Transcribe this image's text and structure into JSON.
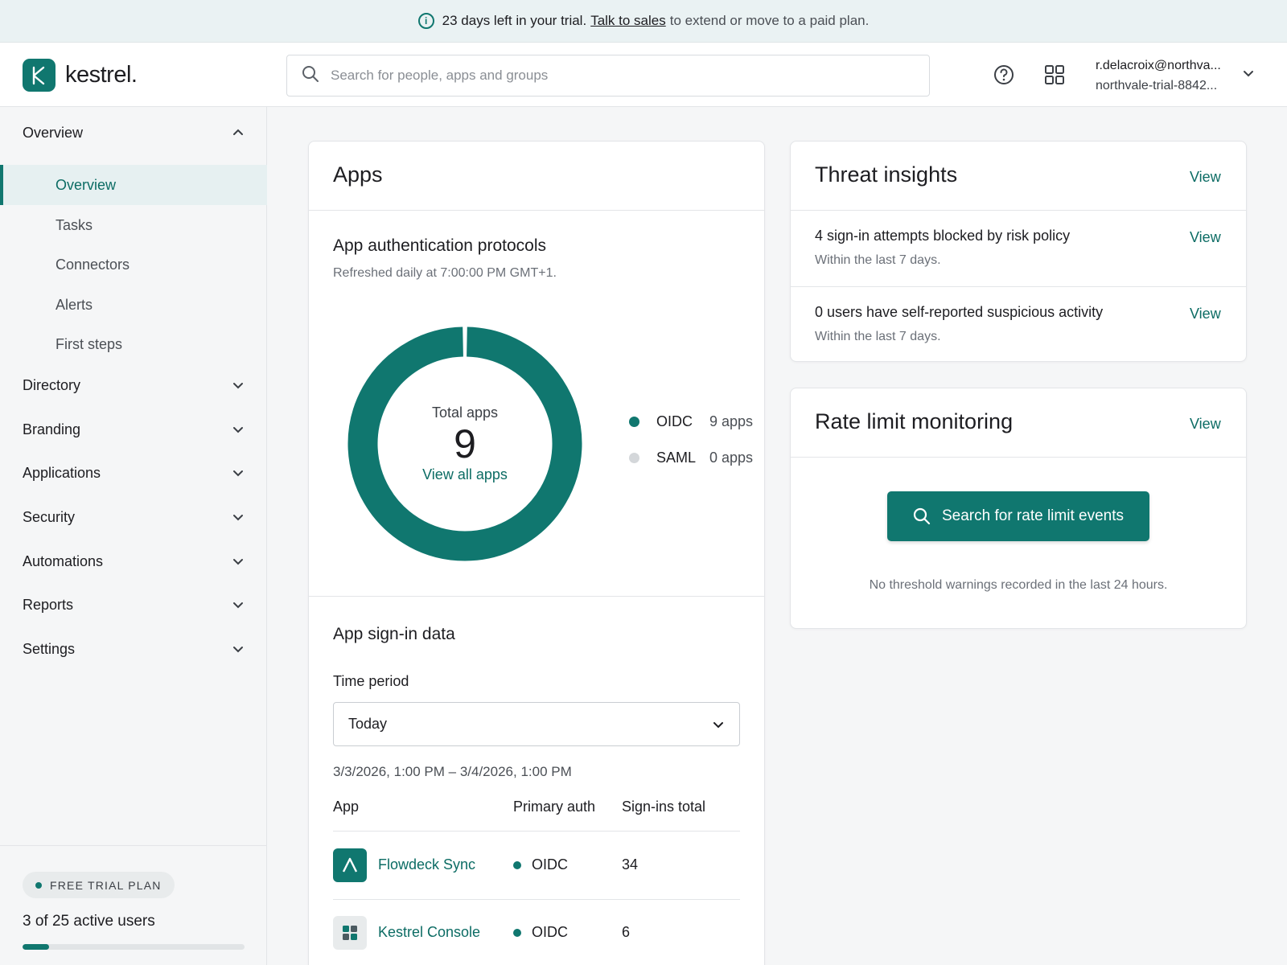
{
  "banner": {
    "bold_text": "23 days left in your trial.",
    "link_text": "Talk to sales",
    "rest_text": "to extend or move to a paid plan."
  },
  "header": {
    "logo_text": "kestrel.",
    "search_placeholder": "Search for people, apps and groups",
    "account_email": "r.delacroix@northva...",
    "account_org": "northvale-trial-8842..."
  },
  "sidebar": {
    "overview_group": "Overview",
    "overview_items": [
      "Overview",
      "Tasks",
      "Connectors",
      "Alerts",
      "First steps"
    ],
    "groups": [
      "Directory",
      "Branding",
      "Applications",
      "Security",
      "Automations",
      "Reports",
      "Settings"
    ],
    "plan_badge": "FREE TRIAL PLAN",
    "active_users_text": "3 of 25 active users",
    "active_users_fraction": 0.12
  },
  "apps_card": {
    "title": "Apps",
    "protocols_heading": "App authentication protocols",
    "refreshed_text": "Refreshed daily at 7:00:00 PM GMT+1.",
    "donut_label": "Total apps",
    "donut_total": "9",
    "donut_link": "View all apps",
    "legend": [
      {
        "name": "OIDC",
        "count": "9 apps",
        "value": 9,
        "color": "#10776f"
      },
      {
        "name": "SAML",
        "count": "0 apps",
        "value": 0,
        "color": "#d4d7da"
      }
    ],
    "signin_heading": "App sign-in data",
    "time_period_label": "Time period",
    "time_period_value": "Today",
    "date_range": "3/3/2026, 1:00 PM – 3/4/2026, 1:00 PM",
    "table_headers": [
      "App",
      "Primary auth",
      "Sign-ins total"
    ],
    "rows": [
      {
        "app": "Flowdeck Sync",
        "auth": "OIDC",
        "total": "34"
      },
      {
        "app": "Kestrel Console",
        "auth": "OIDC",
        "total": "6"
      }
    ]
  },
  "threat_card": {
    "title": "Threat insights",
    "view_label": "View",
    "items": [
      {
        "title": "4 sign-in attempts blocked by risk policy",
        "sub": "Within the last 7 days.",
        "view": "View"
      },
      {
        "title": "0 users have self-reported suspicious activity",
        "sub": "Within the last 7 days.",
        "view": "View"
      }
    ]
  },
  "rate_card": {
    "title": "Rate limit monitoring",
    "view_label": "View",
    "button_label": "Search for rate limit events",
    "note": "No threshold warnings recorded in the last 24 hours."
  },
  "colors": {
    "accent": "#10776f",
    "accent_light": "#e6f0f1",
    "saml_gray": "#d4d7da"
  },
  "icons": [
    "info-icon",
    "search-icon",
    "help-icon",
    "app-grid-icon",
    "chevron-down-icon",
    "chevron-up-icon"
  ]
}
